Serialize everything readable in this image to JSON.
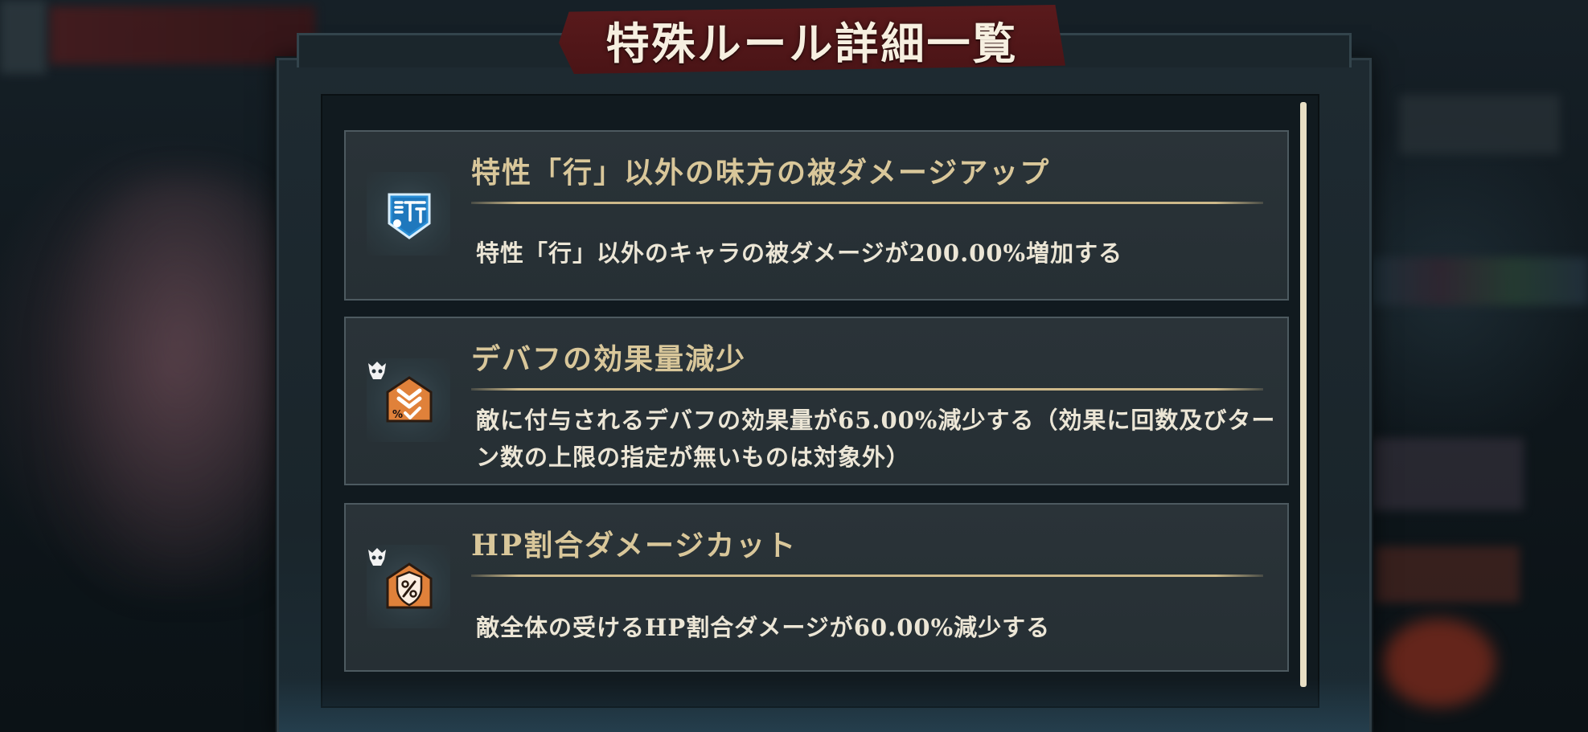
{
  "dialog": {
    "title": "特殊ルール詳細一覧"
  },
  "rules": [
    {
      "title": "特性「行」以外の味方の被ダメージアップ",
      "description": "特性「行」以外のキャラの被ダメージが200.00%増加する",
      "icon": "shield-gyo-icon",
      "icon_color": "#2a8fd6"
    },
    {
      "title": "デバフの効果量減少",
      "description": "敵に付与されるデバフの効果量が65.00%減少する（効果に回数及びターン数の上限の指定が無いものは対象外）",
      "icon": "debuff-down-icon",
      "icon_color": "#e0813a",
      "badge_icon": "skull-icon"
    },
    {
      "title": "HP割合ダメージカット",
      "description": "敵全体の受けるHP割合ダメージが60.00%減少する",
      "icon": "shield-percent-icon",
      "icon_color": "#e0813a",
      "badge_icon": "skull-icon"
    }
  ],
  "colors": {
    "title_banner": "#5a1a1c",
    "card_title": "#d9c79a",
    "card_text": "#ece6d6",
    "scrollbar": "#e8dfc4"
  }
}
